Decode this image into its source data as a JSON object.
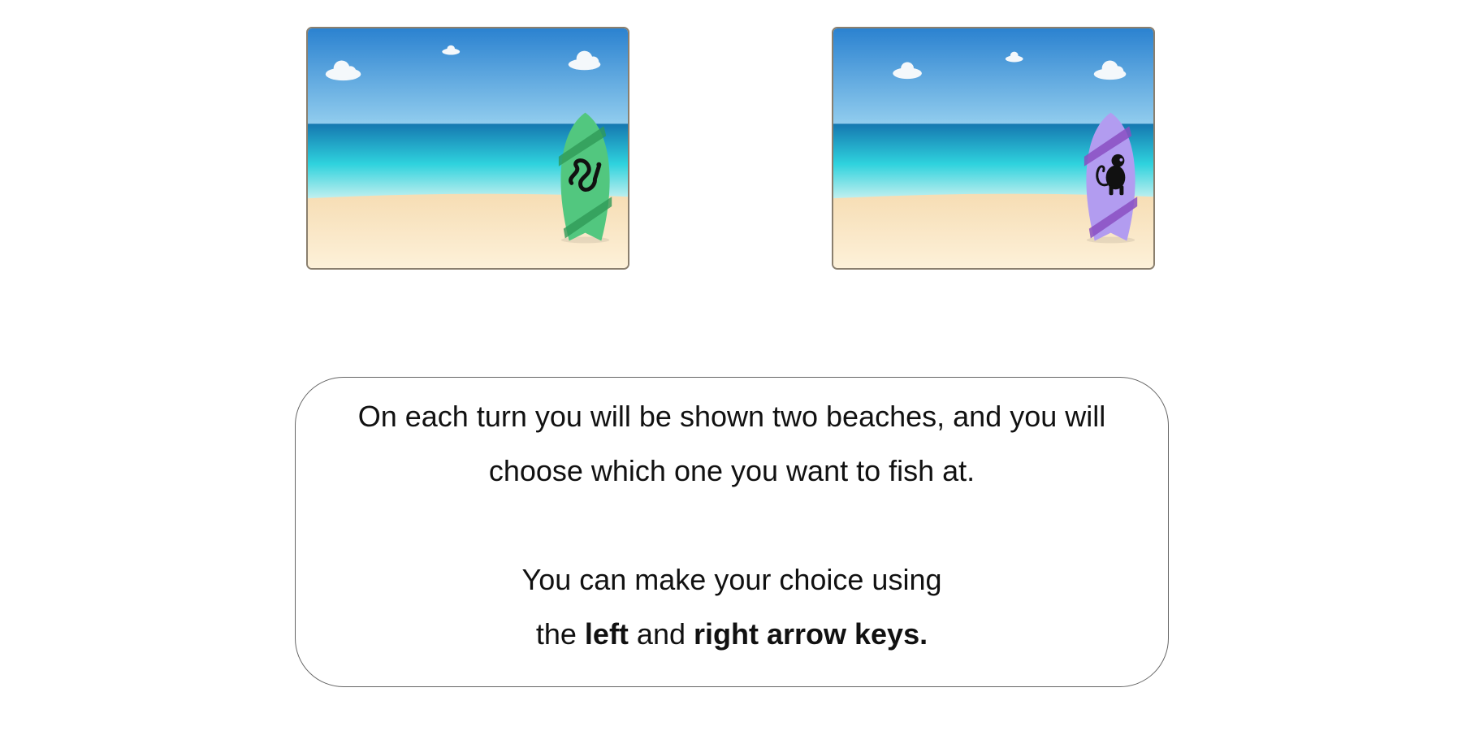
{
  "beaches": {
    "left": {
      "board_color": "#52c77f",
      "stripe_color": "#2f9a58",
      "animal_icon": "snake-icon",
      "key": "left"
    },
    "right": {
      "board_color": "#b29cf0",
      "stripe_color": "#8a4fc2",
      "animal_icon": "monkey-icon",
      "key": "right"
    }
  },
  "instructions": {
    "line1": "On each turn you will be shown two beaches, and you will",
    "line2": "choose which one you want to fish at.",
    "line3": "You can make your choice using",
    "line4_prefix": "the ",
    "line4_left": "left",
    "line4_mid": " and ",
    "line4_right": "right arrow keys."
  },
  "colors": {
    "sky_top": "#2f86d2",
    "sky_bottom": "#8fcbee",
    "sea_dark": "#1a7fb8",
    "sea_light": "#34d0dc",
    "sand": "#fbeed4",
    "frame": "#8a7f6e"
  }
}
